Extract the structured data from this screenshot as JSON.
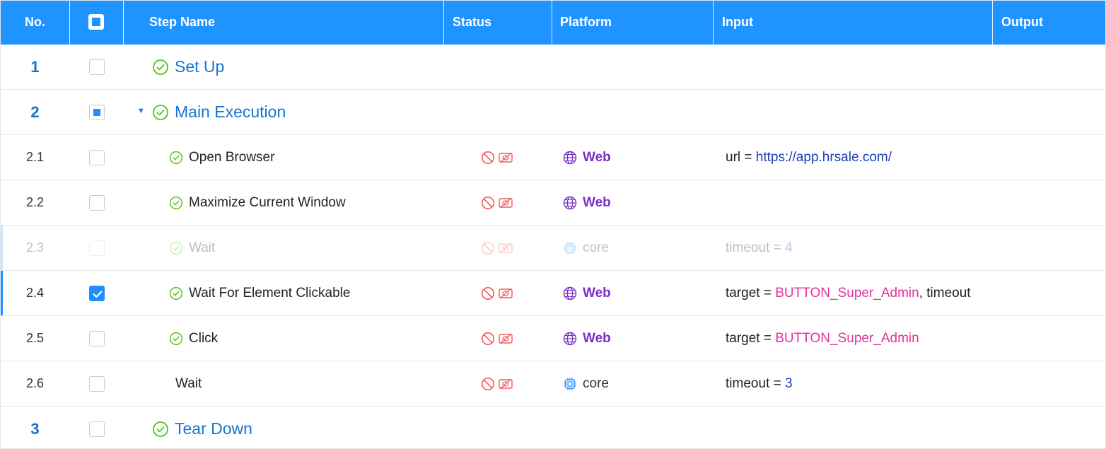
{
  "header": {
    "no": "No.",
    "step_name": "Step Name",
    "status": "Status",
    "platform": "Platform",
    "input": "Input",
    "output": "Output"
  },
  "colors": {
    "header_bg": "#1f93ff",
    "group_text": "#1874d2",
    "success_icon": "#52c41a",
    "status_icon": "#f15a5a",
    "web_platform": "#7a2fc8",
    "core_icon": "#1f8fff",
    "target_value": "#e0339a",
    "link_value": "#1a3fb5"
  },
  "rows": [
    {
      "no": "1",
      "name": "Set Up",
      "group": true,
      "checkbox": "unchecked",
      "status_icon": "check-circle-icon"
    },
    {
      "no": "2",
      "name": "Main Execution",
      "group": true,
      "expanded": true,
      "checkbox": "partial",
      "status_icon": "check-circle-icon"
    },
    {
      "no": "2.1",
      "name": "Open Browser",
      "checkbox": "unchecked",
      "status_icon": "check-circle-icon",
      "platform": "Web",
      "platform_icon": "globe-icon",
      "input": {
        "key": "url",
        "eq": " = ",
        "value": "https://app.hrsale.com/",
        "extra": ""
      }
    },
    {
      "no": "2.2",
      "name": "Maximize Current Window",
      "checkbox": "unchecked",
      "status_icon": "check-circle-icon",
      "platform": "Web",
      "platform_icon": "globe-icon"
    },
    {
      "no": "2.3",
      "name": "Wait",
      "disabled": true,
      "checkbox": "unchecked",
      "status_icon": "check-circle-icon",
      "platform": "core",
      "platform_icon": "chip-icon",
      "input": {
        "key": "timeout",
        "eq": " = ",
        "value": "4",
        "extra": ""
      }
    },
    {
      "no": "2.4",
      "name": "Wait For Element Clickable",
      "selected": true,
      "checkbox": "checked",
      "status_icon": "check-circle-icon",
      "platform": "Web",
      "platform_icon": "globe-icon",
      "input": {
        "key": "target",
        "eq": " = ",
        "value": "BUTTON_Super_Admin",
        "extra": ", timeout"
      }
    },
    {
      "no": "2.5",
      "name": "Click",
      "checkbox": "unchecked",
      "status_icon": "check-circle-icon",
      "platform": "Web",
      "platform_icon": "globe-icon",
      "input": {
        "key": "target",
        "eq": " = ",
        "value": "BUTTON_Super_Admin",
        "extra": ""
      }
    },
    {
      "no": "2.6",
      "name": "Wait",
      "checkbox": "unchecked",
      "platform": "core",
      "platform_icon": "chip-icon",
      "input": {
        "key": "timeout",
        "eq": " = ",
        "value": "3",
        "extra": ""
      }
    },
    {
      "no": "3",
      "name": "Tear Down",
      "group": true,
      "checkbox": "unchecked",
      "status_icon": "check-circle-icon"
    }
  ]
}
